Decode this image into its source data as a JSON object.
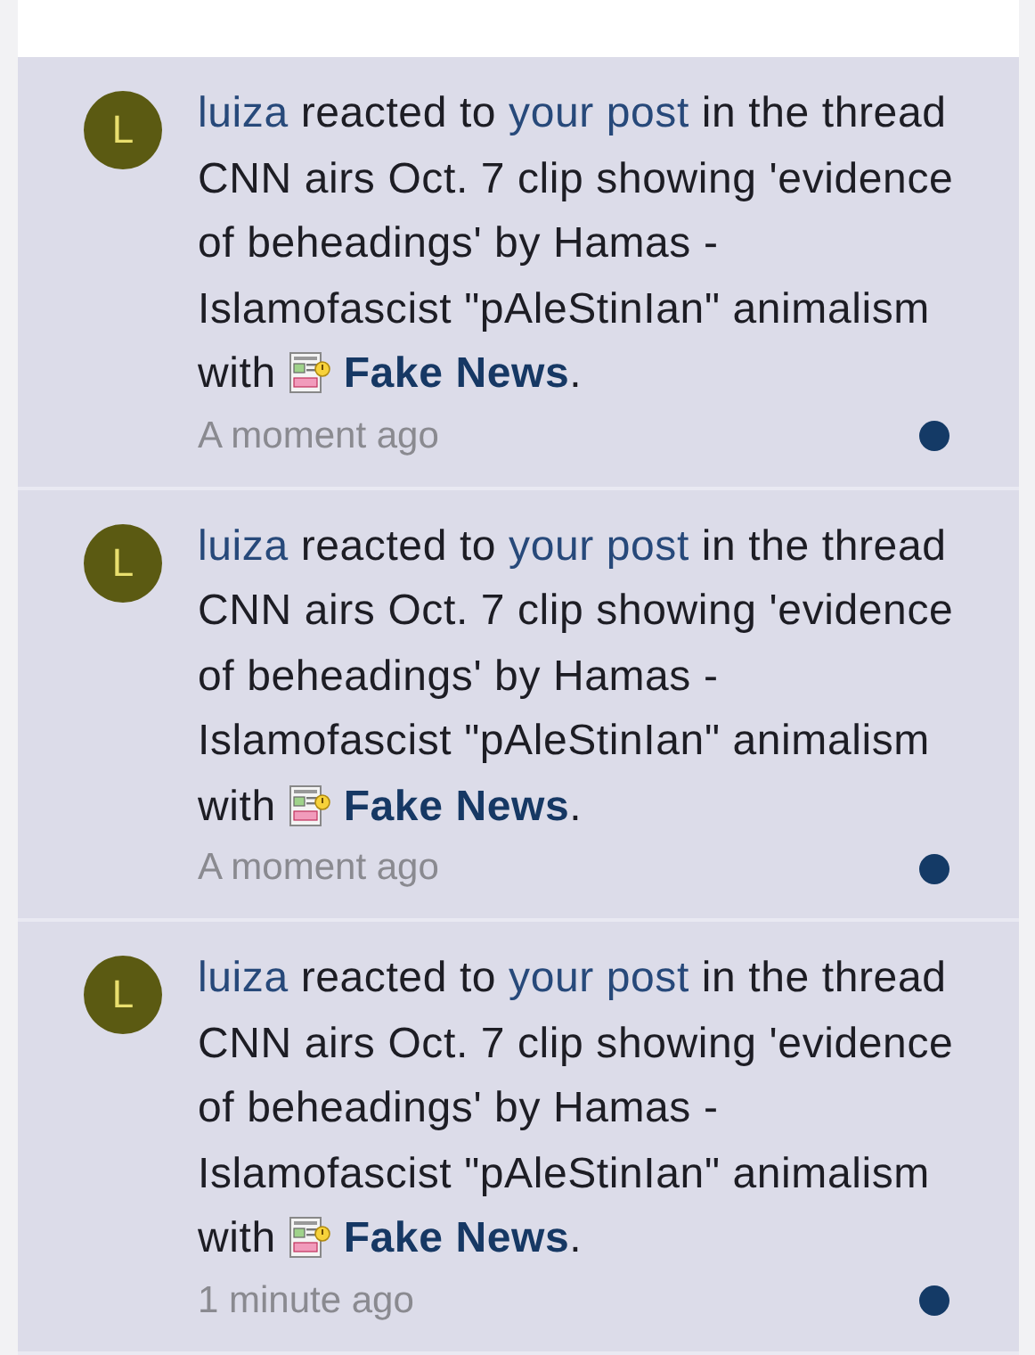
{
  "notifications": [
    {
      "avatar_letter": "L",
      "actor": "luiza",
      "verb": " reacted to ",
      "link": "your post",
      "context": " in the thread CNN airs Oct. 7 clip showing 'evidence of beheadings' by Hamas - Islamofascist \"pAleStinIan\" animalism with ",
      "reaction": "Fake News",
      "end": ".",
      "time": "A moment ago",
      "unread": true
    },
    {
      "avatar_letter": "L",
      "actor": "luiza",
      "verb": " reacted to ",
      "link": "your post",
      "context": " in the thread CNN airs Oct. 7 clip showing 'evidence of beheadings' by Hamas - Islamofascist \"pAleStinIan\" animalism with ",
      "reaction": "Fake News",
      "end": ".",
      "time": "A moment ago",
      "unread": true
    },
    {
      "avatar_letter": "L",
      "actor": "luiza",
      "verb": " reacted to ",
      "link": "your post",
      "context": " in the thread CNN airs Oct. 7 clip showing 'evidence of beheadings' by Hamas - Islamofascist \"pAleStinIan\" animalism with ",
      "reaction": "Fake News",
      "end": ".",
      "time": "1 minute ago",
      "unread": true
    }
  ]
}
